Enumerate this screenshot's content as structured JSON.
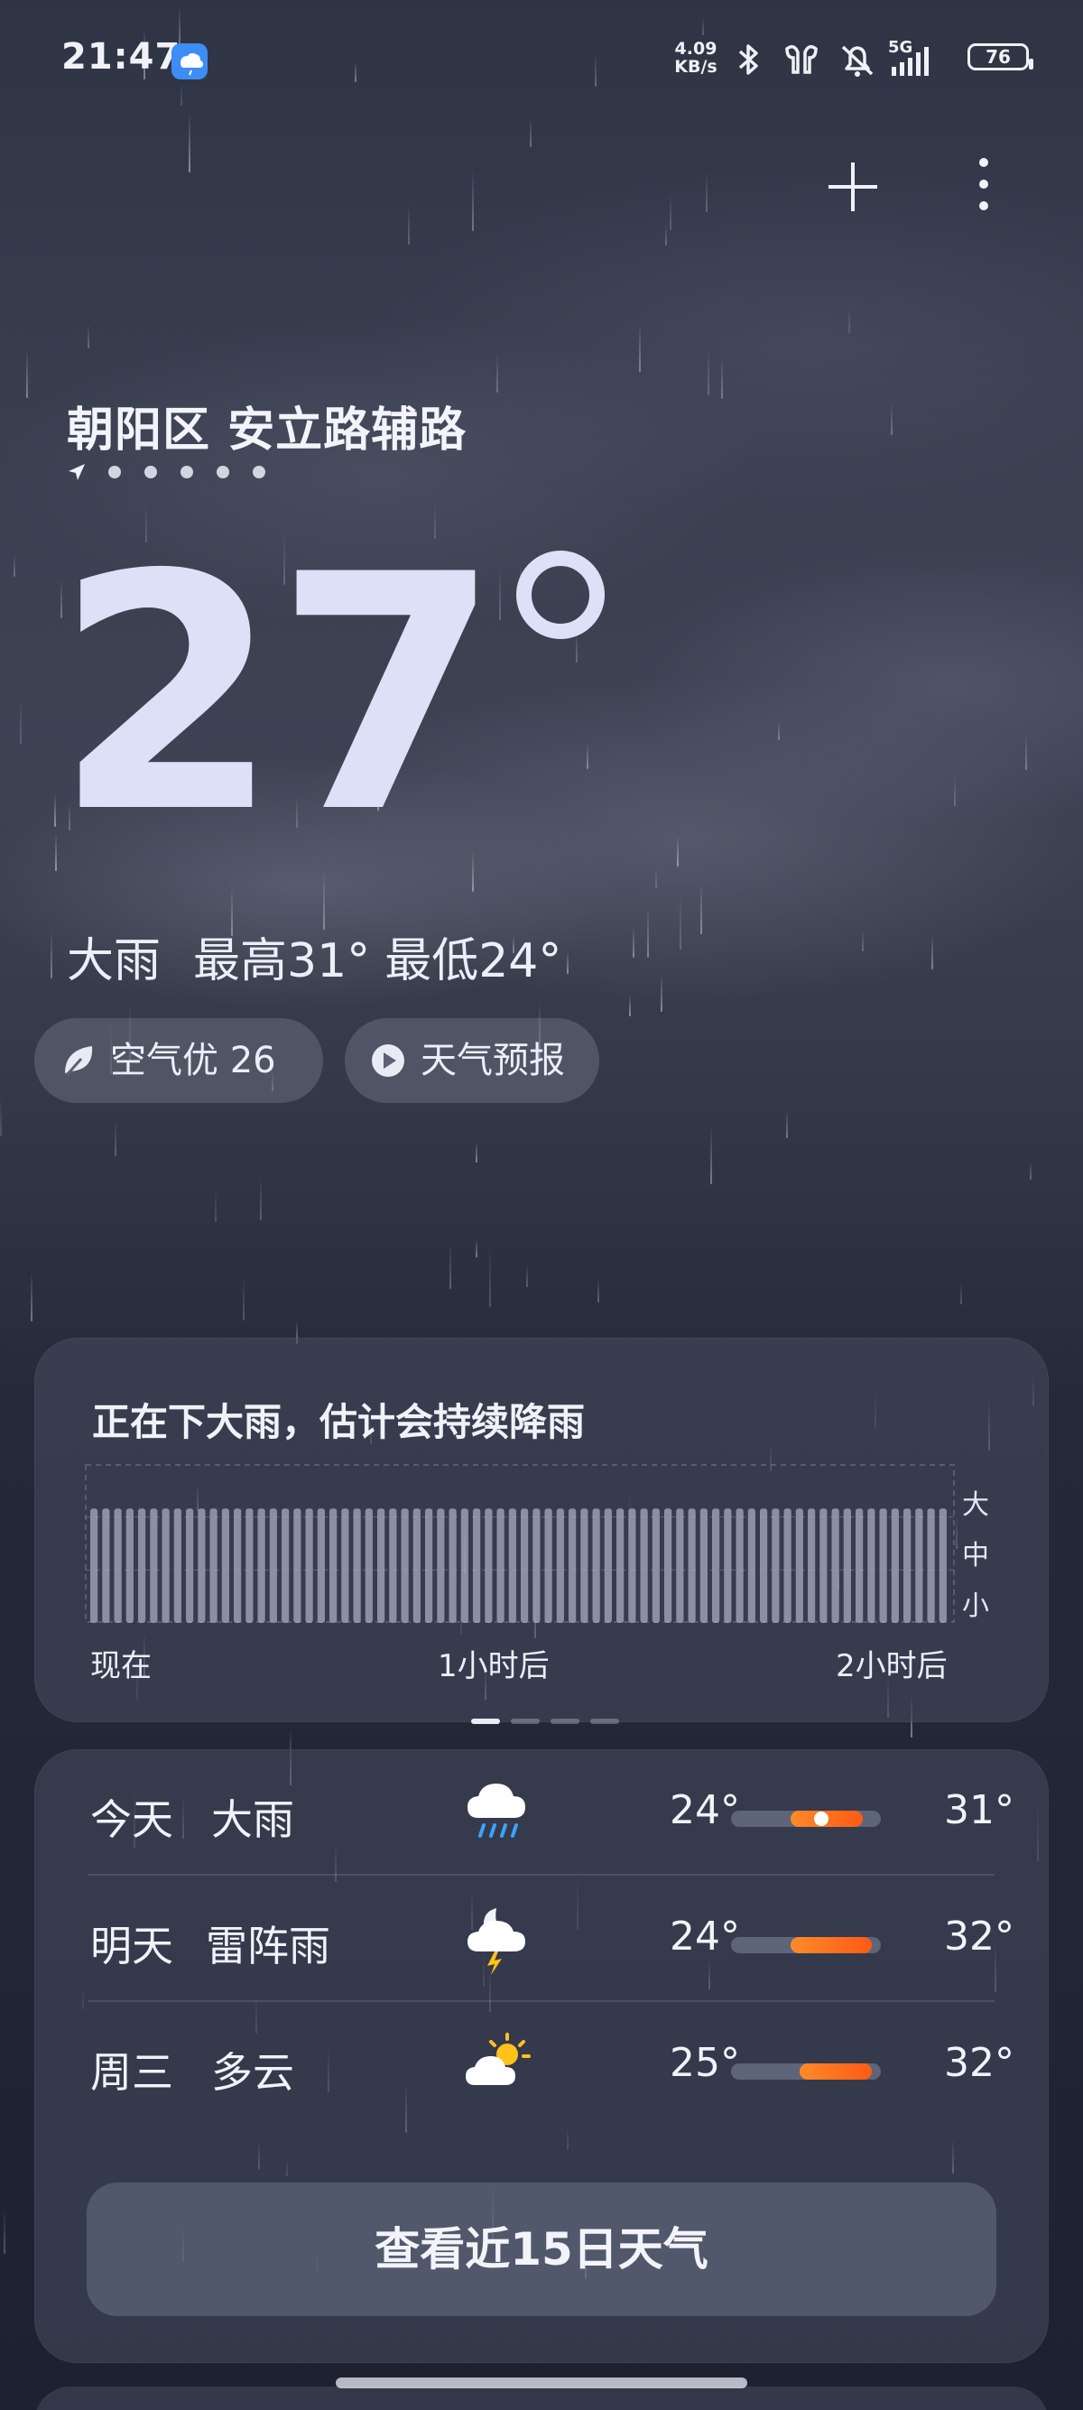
{
  "status_bar": {
    "time": "21:47",
    "net_speed_value": "4.09",
    "net_speed_unit": "KB/s",
    "network": "5G",
    "battery": "76",
    "icons": [
      "weather-app-icon",
      "bluetooth-icon",
      "earbuds-icon",
      "mute-icon",
      "signal-icon",
      "battery-icon"
    ]
  },
  "header": {
    "actions": [
      "add-icon",
      "more-icon"
    ]
  },
  "location": {
    "name": "朝阳区 安立路辅路",
    "page_count": 6,
    "current_page": 1
  },
  "current": {
    "temperature": "27",
    "condition": "大雨",
    "high": "最高31°",
    "low": "最低24°"
  },
  "pills": {
    "air_quality": "空气优 26",
    "forecast_video": "天气预报"
  },
  "precipitation": {
    "title": "正在下大雨，估计会持续降雨",
    "levels": [
      "大",
      "中",
      "小"
    ],
    "time_labels": [
      "现在",
      "1小时后",
      "2小时后"
    ],
    "intensity_level": 0.72,
    "bars": 72,
    "pages": 4,
    "active_page": 1
  },
  "forecast": {
    "rows": [
      {
        "day": "今天",
        "desc": "大雨",
        "icon": "cloud-rain-icon",
        "low": "24°",
        "high": "31°",
        "range": [
          0.4,
          0.88
        ],
        "current": 0.6
      },
      {
        "day": "明天",
        "desc": "雷阵雨",
        "icon": "cloud-moon-thunder-icon",
        "low": "24°",
        "high": "32°",
        "range": [
          0.4,
          0.94
        ]
      },
      {
        "day": "周三",
        "desc": "多云",
        "icon": "sun-cloud-icon",
        "low": "25°",
        "high": "32°",
        "range": [
          0.46,
          0.94
        ]
      }
    ],
    "more_button": "查看近15日天气"
  },
  "colors": {
    "accent": "#ff6a1a",
    "temperature_text": "#dde1f7"
  }
}
